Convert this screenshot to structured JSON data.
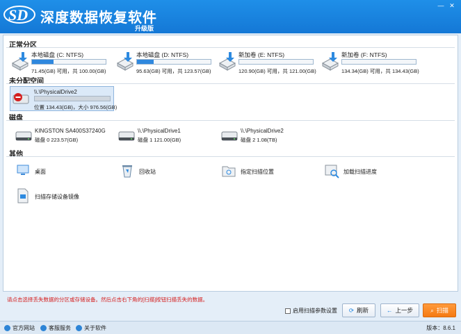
{
  "app": {
    "title": "深度数据恢复软件",
    "subtitle": "升级版",
    "logo_text": "SD"
  },
  "window": {
    "minimize": "—",
    "close": "✕"
  },
  "sections": {
    "normal": "正常分区",
    "unallocated": "未分配空间",
    "disks": "磁盘",
    "other": "其他"
  },
  "partitions": [
    {
      "name": "本地磁盘 (C: NTFS)",
      "info": "71.45(GB) 可用，共 100.00(GB)",
      "used": 0.29
    },
    {
      "name": "本地磁盘 (D: NTFS)",
      "info": "95.63(GB) 可用，共 123.57(GB)",
      "used": 0.23
    },
    {
      "name": "新加卷 (E: NTFS)",
      "info": "120.90(GB) 可用，共 121.00(GB)",
      "used": 0.0
    },
    {
      "name": "新加卷 (F: NTFS)",
      "info": "134.34(GB) 可用，共 134.43(GB)",
      "used": 0.0
    }
  ],
  "unallocated": {
    "name": "\\\\.\\PhysicalDrive2",
    "info": "位置 134.43(GB)，大小 976.56(GB)"
  },
  "disks": [
    {
      "name": "KINGSTON SA400S37240G",
      "info": "磁盘 0    223.57(GB)"
    },
    {
      "name": "\\\\.\\PhysicalDrive1",
      "info": "磁盘 1    121.00(GB)"
    },
    {
      "name": "\\\\.\\PhysicalDrive2",
      "info": "磁盘 2    1.08(TB)"
    }
  ],
  "other": [
    {
      "name": "桌面",
      "icon": "desktop-icon"
    },
    {
      "name": "回收站",
      "icon": "recycle-bin-icon"
    },
    {
      "name": "指定扫描位置",
      "icon": "folder-target-icon"
    },
    {
      "name": "加载扫描进度",
      "icon": "load-progress-icon"
    },
    {
      "name": "扫描存储设备镜像",
      "icon": "image-file-icon"
    }
  ],
  "footer": {
    "hint": "请点击选择丢失数据的分区或存储设备。然后点击右下角的[扫描]按钮扫描丢失的数据。",
    "advanced_label": "启用扫描参数设置",
    "refresh_label": "刷新",
    "back_label": "上一步",
    "scan_label": "扫描"
  },
  "statusbar": {
    "site": "官方网站",
    "support": "客服服务",
    "about": "关于软件",
    "version": "版本：8.6.1"
  },
  "colors": {
    "accent": "#1a82e0",
    "scan": "#f57a12",
    "hint": "#d52020"
  }
}
